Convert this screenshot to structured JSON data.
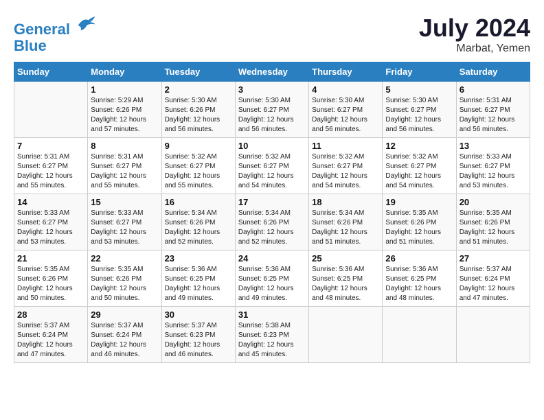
{
  "header": {
    "logo_line1": "General",
    "logo_line2": "Blue",
    "month_year": "July 2024",
    "location": "Marbat, Yemen"
  },
  "days_of_week": [
    "Sunday",
    "Monday",
    "Tuesday",
    "Wednesday",
    "Thursday",
    "Friday",
    "Saturday"
  ],
  "weeks": [
    [
      {
        "num": "",
        "info": ""
      },
      {
        "num": "1",
        "info": "Sunrise: 5:29 AM\nSunset: 6:26 PM\nDaylight: 12 hours\nand 57 minutes."
      },
      {
        "num": "2",
        "info": "Sunrise: 5:30 AM\nSunset: 6:26 PM\nDaylight: 12 hours\nand 56 minutes."
      },
      {
        "num": "3",
        "info": "Sunrise: 5:30 AM\nSunset: 6:27 PM\nDaylight: 12 hours\nand 56 minutes."
      },
      {
        "num": "4",
        "info": "Sunrise: 5:30 AM\nSunset: 6:27 PM\nDaylight: 12 hours\nand 56 minutes."
      },
      {
        "num": "5",
        "info": "Sunrise: 5:30 AM\nSunset: 6:27 PM\nDaylight: 12 hours\nand 56 minutes."
      },
      {
        "num": "6",
        "info": "Sunrise: 5:31 AM\nSunset: 6:27 PM\nDaylight: 12 hours\nand 56 minutes."
      }
    ],
    [
      {
        "num": "7",
        "info": "Sunrise: 5:31 AM\nSunset: 6:27 PM\nDaylight: 12 hours\nand 55 minutes."
      },
      {
        "num": "8",
        "info": "Sunrise: 5:31 AM\nSunset: 6:27 PM\nDaylight: 12 hours\nand 55 minutes."
      },
      {
        "num": "9",
        "info": "Sunrise: 5:32 AM\nSunset: 6:27 PM\nDaylight: 12 hours\nand 55 minutes."
      },
      {
        "num": "10",
        "info": "Sunrise: 5:32 AM\nSunset: 6:27 PM\nDaylight: 12 hours\nand 54 minutes."
      },
      {
        "num": "11",
        "info": "Sunrise: 5:32 AM\nSunset: 6:27 PM\nDaylight: 12 hours\nand 54 minutes."
      },
      {
        "num": "12",
        "info": "Sunrise: 5:32 AM\nSunset: 6:27 PM\nDaylight: 12 hours\nand 54 minutes."
      },
      {
        "num": "13",
        "info": "Sunrise: 5:33 AM\nSunset: 6:27 PM\nDaylight: 12 hours\nand 53 minutes."
      }
    ],
    [
      {
        "num": "14",
        "info": "Sunrise: 5:33 AM\nSunset: 6:27 PM\nDaylight: 12 hours\nand 53 minutes."
      },
      {
        "num": "15",
        "info": "Sunrise: 5:33 AM\nSunset: 6:27 PM\nDaylight: 12 hours\nand 53 minutes."
      },
      {
        "num": "16",
        "info": "Sunrise: 5:34 AM\nSunset: 6:26 PM\nDaylight: 12 hours\nand 52 minutes."
      },
      {
        "num": "17",
        "info": "Sunrise: 5:34 AM\nSunset: 6:26 PM\nDaylight: 12 hours\nand 52 minutes."
      },
      {
        "num": "18",
        "info": "Sunrise: 5:34 AM\nSunset: 6:26 PM\nDaylight: 12 hours\nand 51 minutes."
      },
      {
        "num": "19",
        "info": "Sunrise: 5:35 AM\nSunset: 6:26 PM\nDaylight: 12 hours\nand 51 minutes."
      },
      {
        "num": "20",
        "info": "Sunrise: 5:35 AM\nSunset: 6:26 PM\nDaylight: 12 hours\nand 51 minutes."
      }
    ],
    [
      {
        "num": "21",
        "info": "Sunrise: 5:35 AM\nSunset: 6:26 PM\nDaylight: 12 hours\nand 50 minutes."
      },
      {
        "num": "22",
        "info": "Sunrise: 5:35 AM\nSunset: 6:26 PM\nDaylight: 12 hours\nand 50 minutes."
      },
      {
        "num": "23",
        "info": "Sunrise: 5:36 AM\nSunset: 6:25 PM\nDaylight: 12 hours\nand 49 minutes."
      },
      {
        "num": "24",
        "info": "Sunrise: 5:36 AM\nSunset: 6:25 PM\nDaylight: 12 hours\nand 49 minutes."
      },
      {
        "num": "25",
        "info": "Sunrise: 5:36 AM\nSunset: 6:25 PM\nDaylight: 12 hours\nand 48 minutes."
      },
      {
        "num": "26",
        "info": "Sunrise: 5:36 AM\nSunset: 6:25 PM\nDaylight: 12 hours\nand 48 minutes."
      },
      {
        "num": "27",
        "info": "Sunrise: 5:37 AM\nSunset: 6:24 PM\nDaylight: 12 hours\nand 47 minutes."
      }
    ],
    [
      {
        "num": "28",
        "info": "Sunrise: 5:37 AM\nSunset: 6:24 PM\nDaylight: 12 hours\nand 47 minutes."
      },
      {
        "num": "29",
        "info": "Sunrise: 5:37 AM\nSunset: 6:24 PM\nDaylight: 12 hours\nand 46 minutes."
      },
      {
        "num": "30",
        "info": "Sunrise: 5:37 AM\nSunset: 6:23 PM\nDaylight: 12 hours\nand 46 minutes."
      },
      {
        "num": "31",
        "info": "Sunrise: 5:38 AM\nSunset: 6:23 PM\nDaylight: 12 hours\nand 45 minutes."
      },
      {
        "num": "",
        "info": ""
      },
      {
        "num": "",
        "info": ""
      },
      {
        "num": "",
        "info": ""
      }
    ]
  ]
}
